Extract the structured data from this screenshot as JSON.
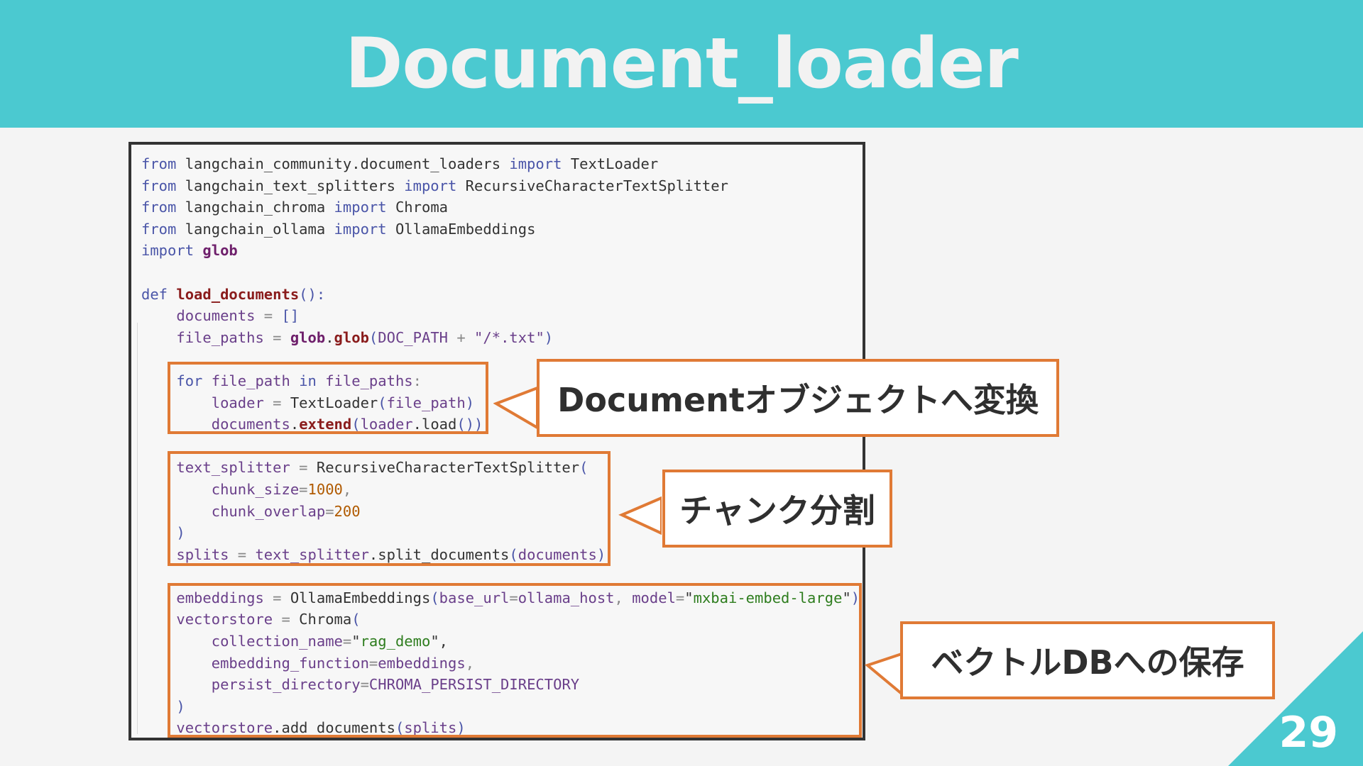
{
  "slide": {
    "title": "Document_loader",
    "page_number": "29"
  },
  "code": {
    "lines": [
      [
        {
          "t": "from",
          "c": "kw"
        },
        {
          "t": " langchain_community.document_loaders "
        },
        {
          "t": "import",
          "c": "kw"
        },
        {
          "t": " TextLoader"
        }
      ],
      [
        {
          "t": "from",
          "c": "kw"
        },
        {
          "t": " langchain_text_splitters "
        },
        {
          "t": "import",
          "c": "kw"
        },
        {
          "t": " RecursiveCharacterTextSplitter"
        }
      ],
      [
        {
          "t": "from",
          "c": "kw"
        },
        {
          "t": " langchain_chroma "
        },
        {
          "t": "import",
          "c": "kw"
        },
        {
          "t": " Chroma"
        }
      ],
      [
        {
          "t": "from",
          "c": "kw"
        },
        {
          "t": " langchain_ollama "
        },
        {
          "t": "import",
          "c": "kw"
        },
        {
          "t": " OllamaEmbeddings"
        }
      ],
      [
        {
          "t": "import",
          "c": "kw"
        },
        {
          "t": " "
        },
        {
          "t": "glob",
          "c": "mod"
        }
      ],
      [],
      [
        {
          "t": "def",
          "c": "kw"
        },
        {
          "t": " "
        },
        {
          "t": "load_documents",
          "c": "fn"
        },
        {
          "t": "():",
          "c": "kw"
        }
      ],
      [
        {
          "t": "    "
        },
        {
          "t": "documents",
          "c": "var"
        },
        {
          "t": " = ",
          "c": "op"
        },
        {
          "t": "[]",
          "c": "kw"
        }
      ],
      [
        {
          "t": "    "
        },
        {
          "t": "file_paths",
          "c": "var"
        },
        {
          "t": " = ",
          "c": "op"
        },
        {
          "t": "glob",
          "c": "mod"
        },
        {
          "t": "."
        },
        {
          "t": "glob",
          "c": "fn"
        },
        {
          "t": "(",
          "c": "kw"
        },
        {
          "t": "DOC_PATH",
          "c": "var"
        },
        {
          "t": " + ",
          "c": "op"
        },
        {
          "t": "\"/*.txt\"",
          "c": "var"
        },
        {
          "t": ")",
          "c": "kw"
        }
      ],
      [],
      [
        {
          "t": "    "
        },
        {
          "t": "for",
          "c": "kw"
        },
        {
          "t": " "
        },
        {
          "t": "file_path",
          "c": "var"
        },
        {
          "t": " "
        },
        {
          "t": "in",
          "c": "kw"
        },
        {
          "t": " "
        },
        {
          "t": "file_paths",
          "c": "var"
        },
        {
          "t": ":",
          "c": "op"
        }
      ],
      [
        {
          "t": "        "
        },
        {
          "t": "loader",
          "c": "var"
        },
        {
          "t": " = ",
          "c": "op"
        },
        {
          "t": "TextLoader"
        },
        {
          "t": "(",
          "c": "kw"
        },
        {
          "t": "file_path",
          "c": "var"
        },
        {
          "t": ")",
          "c": "kw"
        }
      ],
      [
        {
          "t": "        "
        },
        {
          "t": "documents",
          "c": "var"
        },
        {
          "t": "."
        },
        {
          "t": "extend",
          "c": "fn"
        },
        {
          "t": "(",
          "c": "kw"
        },
        {
          "t": "loader",
          "c": "var"
        },
        {
          "t": ".load"
        },
        {
          "t": "())",
          "c": "kw"
        }
      ],
      [],
      [
        {
          "t": "    "
        },
        {
          "t": "text_splitter",
          "c": "var"
        },
        {
          "t": " = ",
          "c": "op"
        },
        {
          "t": "RecursiveCharacterTextSplitter"
        },
        {
          "t": "(",
          "c": "kw"
        }
      ],
      [
        {
          "t": "        "
        },
        {
          "t": "chunk_size",
          "c": "var"
        },
        {
          "t": "=",
          "c": "op"
        },
        {
          "t": "1000",
          "c": "num"
        },
        {
          "t": ",",
          "c": "op"
        }
      ],
      [
        {
          "t": "        "
        },
        {
          "t": "chunk_overlap",
          "c": "var"
        },
        {
          "t": "=",
          "c": "op"
        },
        {
          "t": "200",
          "c": "num"
        }
      ],
      [
        {
          "t": "    "
        },
        {
          "t": ")",
          "c": "kw"
        }
      ],
      [
        {
          "t": "    "
        },
        {
          "t": "splits",
          "c": "var"
        },
        {
          "t": " = ",
          "c": "op"
        },
        {
          "t": "text_splitter",
          "c": "var"
        },
        {
          "t": ".split_documents"
        },
        {
          "t": "(",
          "c": "kw"
        },
        {
          "t": "documents",
          "c": "var"
        },
        {
          "t": ")",
          "c": "kw"
        }
      ],
      [],
      [
        {
          "t": "    "
        },
        {
          "t": "embeddings",
          "c": "var"
        },
        {
          "t": " = ",
          "c": "op"
        },
        {
          "t": "OllamaEmbeddings"
        },
        {
          "t": "(",
          "c": "kw"
        },
        {
          "t": "base_url",
          "c": "var"
        },
        {
          "t": "=",
          "c": "op"
        },
        {
          "t": "ollama_host",
          "c": "var"
        },
        {
          "t": ", ",
          "c": "op"
        },
        {
          "t": "model",
          "c": "var"
        },
        {
          "t": "=",
          "c": "op"
        },
        {
          "t": "\""
        },
        {
          "t": "mxbai-embed-large",
          "c": "str"
        },
        {
          "t": "\""
        },
        {
          "t": ")",
          "c": "kw"
        }
      ],
      [
        {
          "t": "    "
        },
        {
          "t": "vectorstore",
          "c": "var"
        },
        {
          "t": " = ",
          "c": "op"
        },
        {
          "t": "Chroma"
        },
        {
          "t": "(",
          "c": "kw"
        }
      ],
      [
        {
          "t": "        "
        },
        {
          "t": "collection_name",
          "c": "var"
        },
        {
          "t": "=",
          "c": "op"
        },
        {
          "t": "\""
        },
        {
          "t": "rag_demo",
          "c": "str"
        },
        {
          "t": "\","
        },
        {
          "t": ""
        }
      ],
      [
        {
          "t": "        "
        },
        {
          "t": "embedding_function",
          "c": "var"
        },
        {
          "t": "=",
          "c": "op"
        },
        {
          "t": "embeddings",
          "c": "var"
        },
        {
          "t": ",",
          "c": "op"
        }
      ],
      [
        {
          "t": "        "
        },
        {
          "t": "persist_directory",
          "c": "var"
        },
        {
          "t": "=",
          "c": "op"
        },
        {
          "t": "CHROMA_PERSIST_DIRECTORY",
          "c": "var"
        }
      ],
      [
        {
          "t": "    "
        },
        {
          "t": ")",
          "c": "kw"
        }
      ],
      [
        {
          "t": "    "
        },
        {
          "t": "vectorstore",
          "c": "var"
        },
        {
          "t": ".add_documents"
        },
        {
          "t": "(",
          "c": "kw"
        },
        {
          "t": "splits",
          "c": "var"
        },
        {
          "t": ")",
          "c": "kw"
        }
      ]
    ]
  },
  "callouts": {
    "document_object": "Documentオブジェクトへ変換",
    "chunk_split": "チャンク分割",
    "vector_db": "ベクトルDBへの保存"
  },
  "colors": {
    "accent": "#4bc9d0",
    "highlight": "#e07a35"
  }
}
